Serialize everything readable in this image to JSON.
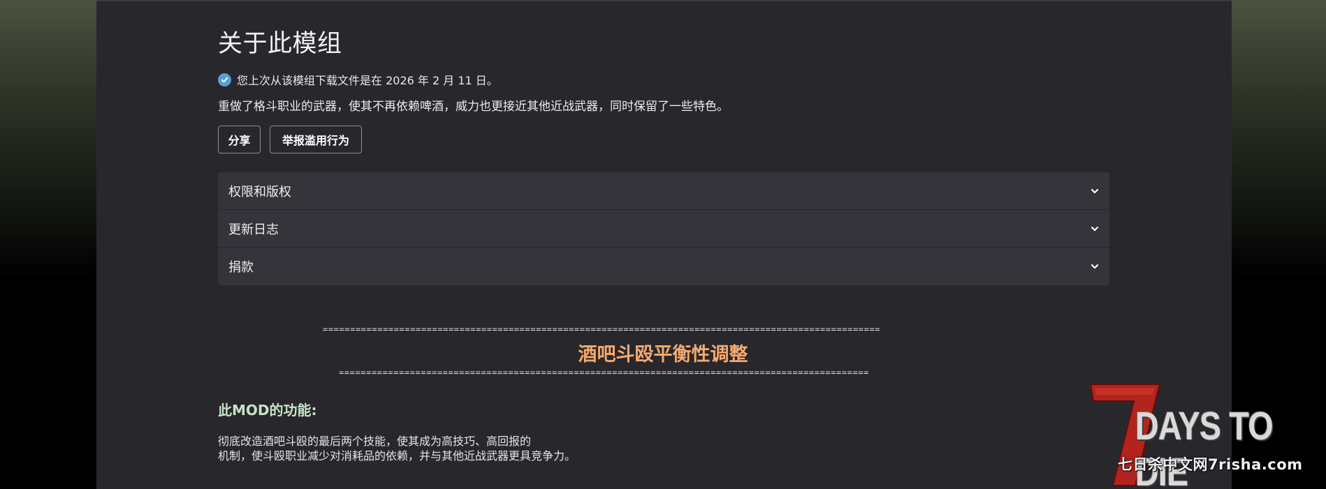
{
  "mod": {
    "title": "关于此模组",
    "download_notice": "您上次从该模组下载文件是在 2026 年 2 月 11 日。",
    "summary": "重做了格斗职业的武器，使其不再依赖啤酒，威力也更接近其他近战武器，同时保留了一些特色。"
  },
  "actions": {
    "share": "分享",
    "report": "举报滥用行为"
  },
  "accordion": [
    {
      "label": "权限和版权"
    },
    {
      "label": "更新日志"
    },
    {
      "label": "捐款"
    }
  ],
  "description": {
    "divider_top": "======================================================================================================",
    "heading": "酒吧斗殴平衡性调整",
    "divider_bottom": "=================================================================================================",
    "features_heading": "此MOD的功能:",
    "features_line1": "彻底改造酒吧斗殴的最后两个技能，使其成为高技巧、高回报的",
    "features_line2": "机制，使斗殴职业减少对消耗品的依赖，并与其他近战武器更具竞争力。"
  },
  "watermark": {
    "logo_text": "DAYS TO DIE",
    "logo_numeral": "7",
    "site_text": "七日杀中文网7risha.com"
  },
  "colors": {
    "panel_bg": "#28272c",
    "accordion_bg": "#35343a",
    "check_blue": "#56a0d6",
    "heading_orange": "#f6a96e",
    "features_green": "#c6e3c9",
    "logo_red": "#b3231d"
  }
}
